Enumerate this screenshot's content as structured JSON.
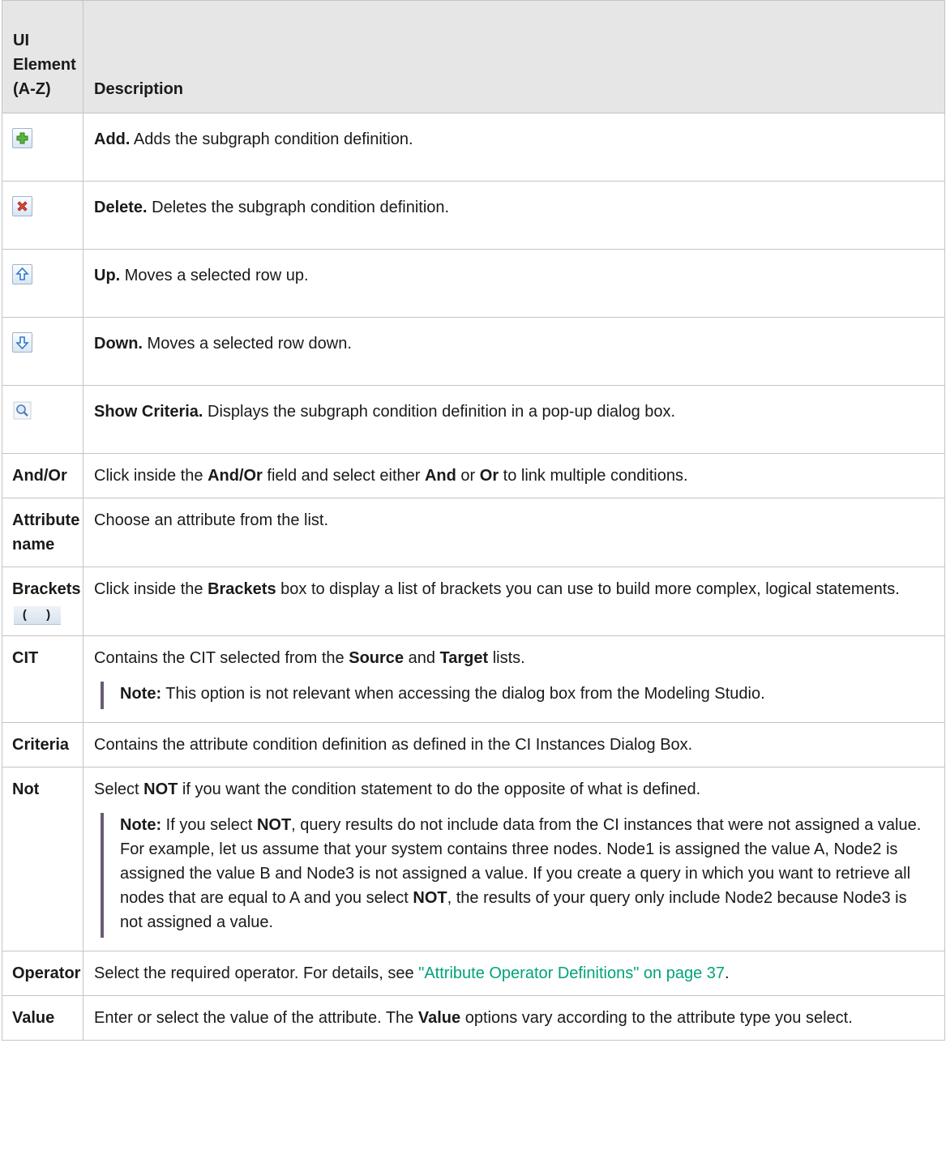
{
  "header": {
    "col1": "UI Element (A-Z)",
    "col2": "Description"
  },
  "icon_rows": [
    {
      "icon": "add-icon",
      "term": "Add.",
      "text": " Adds the subgraph condition definition."
    },
    {
      "icon": "delete-icon",
      "term": "Delete.",
      "text": " Deletes the subgraph condition definition."
    },
    {
      "icon": "up-arrow-icon",
      "term": "Up.",
      "text": " Moves a selected row up."
    },
    {
      "icon": "down-arrow-icon",
      "term": "Down.",
      "text": " Moves a selected row down."
    },
    {
      "icon": "magnifier-icon",
      "term": "Show Criteria.",
      "text": " Displays the subgraph condition definition in a pop-up dialog box."
    }
  ],
  "rows": {
    "and_or": {
      "label": "And/Or",
      "t1": "Click inside the ",
      "b1": "And/Or",
      "t2": " field and select either ",
      "b2": "And",
      "t3": " or ",
      "b3": "Or",
      "t4": " to link multiple conditions."
    },
    "attribute_name": {
      "label": "Attribute name",
      "text": "Choose an attribute from the list."
    },
    "brackets": {
      "label": "Brackets",
      "glyph": "( )",
      "t1": "Click inside the ",
      "b1": "Brackets",
      "t2": " box to display a list of brackets you can use to build more complex, logical statements."
    },
    "cit": {
      "label": "CIT",
      "t1": "Contains the CIT selected from the ",
      "b1": "Source",
      "t2": " and ",
      "b2": "Target",
      "t3": " lists.",
      "note_label": "Note:",
      "note_text": "  This option is not relevant when accessing the dialog box from the Modeling Studio."
    },
    "criteria": {
      "label": "Criteria",
      "text": "Contains the attribute condition definition as defined in the CI Instances Dialog Box."
    },
    "not": {
      "label": "Not",
      "t1": "Select ",
      "b1": "NOT",
      "t2": " if you want the condition statement to do the opposite of what is defined.",
      "note_label": "Note:",
      "n1": "  If you select ",
      "nb1": "NOT",
      "n2": ", query results do not include data from the CI instances that were not assigned a value. For example, let us assume that your system contains three nodes. Node1 is assigned the value A, Node2 is assigned the value B and Node3 is not assigned a value. If you create a query in which you want to retrieve all nodes that are equal to A and you select ",
      "nb2": "NOT",
      "n3": ", the results of your query only include Node2 because Node3 is not assigned a value."
    },
    "operator": {
      "label": "Operator",
      "t1": "Select the required operator. For details, see ",
      "link": "\"Attribute Operator Definitions\" on page 37",
      "t2": "."
    },
    "value": {
      "label": "Value",
      "t1": "Enter or select the value of the attribute. The ",
      "b1": "Value",
      "t2": " options vary according to the attribute type you select."
    }
  }
}
